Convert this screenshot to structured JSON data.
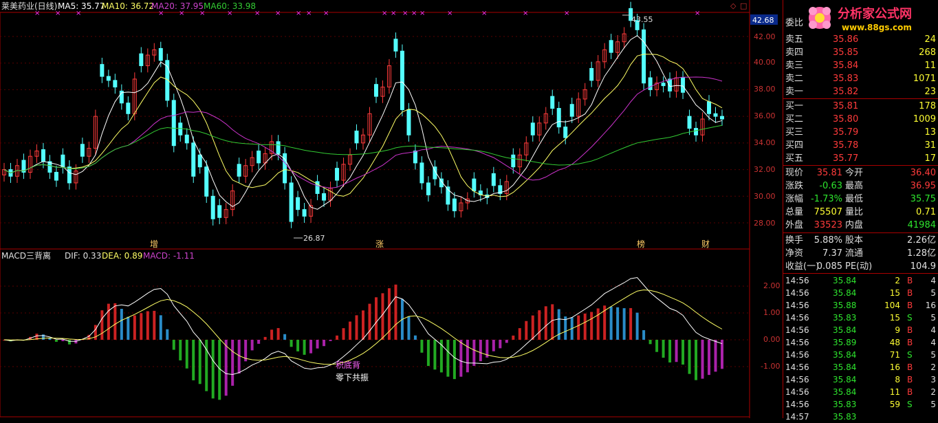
{
  "header": {
    "title": "莱美药业(日线)",
    "ma5": "MA5: 35.77",
    "ma10": "MA10: 36.72",
    "ma20": "MA20: 37.95",
    "ma60": "MA60: 33.98"
  },
  "price_axis": [
    "42.00",
    "40.00",
    "38.00",
    "36.00",
    "34.00",
    "32.00",
    "30.00",
    "28.00"
  ],
  "current_price_tag": "42.68",
  "annotations": {
    "high": "43.55",
    "low": "26.87"
  },
  "markers": [
    "增",
    "涨",
    "榜",
    "财"
  ],
  "macd_header": {
    "name": "MACD三背离",
    "dif": "DIF: 0.33",
    "dea": "DEA: 0.89",
    "macd": "MACD: -1.11"
  },
  "macd_axis": [
    "2.00",
    "1.00",
    "0.00",
    "-1.00"
  ],
  "macd_notes": [
    "积底背",
    "零下共振"
  ],
  "logo": {
    "title": "分析家公式网",
    "url": "www.88gs.com"
  },
  "orderbook": {
    "partial_label": "委比",
    "sells": [
      {
        "label": "卖五",
        "price": "35.86",
        "vol": "24"
      },
      {
        "label": "卖四",
        "price": "35.85",
        "vol": "268"
      },
      {
        "label": "卖三",
        "price": "35.84",
        "vol": "11"
      },
      {
        "label": "卖二",
        "price": "35.83",
        "vol": "1071"
      },
      {
        "label": "卖一",
        "price": "35.82",
        "vol": "23"
      }
    ],
    "buys": [
      {
        "label": "买一",
        "price": "35.81",
        "vol": "178"
      },
      {
        "label": "买二",
        "price": "35.80",
        "vol": "1009"
      },
      {
        "label": "买三",
        "price": "35.79",
        "vol": "13"
      },
      {
        "label": "买四",
        "price": "35.78",
        "vol": "31"
      },
      {
        "label": "买五",
        "price": "35.77",
        "vol": "17"
      }
    ]
  },
  "quote": [
    {
      "l1": "现价",
      "v1": "35.81",
      "c1": "up",
      "l2": "今开",
      "v2": "36.40",
      "c2": "up"
    },
    {
      "l1": "涨跌",
      "v1": "-0.63",
      "c1": "dn",
      "l2": "最高",
      "v2": "36.95",
      "c2": "up"
    },
    {
      "l1": "涨幅",
      "v1": "-1.73%",
      "c1": "dn",
      "l2": "最低",
      "v2": "35.75",
      "c2": "dn"
    },
    {
      "l1": "总量",
      "v1": "75507",
      "c1": "yel",
      "l2": "量比",
      "v2": "0.71",
      "c2": "yel"
    },
    {
      "l1": "外盘",
      "v1": "33523",
      "c1": "up",
      "l2": "内盘",
      "v2": "41984",
      "c2": "dn"
    }
  ],
  "fundamentals": [
    {
      "l1": "换手",
      "v1": "5.88%",
      "l2": "股本",
      "v2": "2.26亿"
    },
    {
      "l1": "净资",
      "v1": "7.37",
      "l2": "流通",
      "v2": "1.28亿"
    },
    {
      "l1": "收益(一)",
      "v1": "0.085",
      "l2": "PE(动)",
      "v2": "104.9"
    }
  ],
  "trades": [
    {
      "time": "14:56",
      "price": "35.84",
      "vol": "2",
      "side": "B",
      "n": "4"
    },
    {
      "time": "14:56",
      "price": "35.84",
      "vol": "15",
      "side": "B",
      "n": "5"
    },
    {
      "time": "14:56",
      "price": "35.88",
      "vol": "104",
      "side": "B",
      "n": "16"
    },
    {
      "time": "14:56",
      "price": "35.83",
      "vol": "15",
      "side": "S",
      "n": "5"
    },
    {
      "time": "14:56",
      "price": "35.84",
      "vol": "9",
      "side": "B",
      "n": "4"
    },
    {
      "time": "14:56",
      "price": "35.89",
      "vol": "48",
      "side": "B",
      "n": "4"
    },
    {
      "time": "14:56",
      "price": "35.84",
      "vol": "71",
      "side": "S",
      "n": "5"
    },
    {
      "time": "14:56",
      "price": "35.84",
      "vol": "16",
      "side": "B",
      "n": "2"
    },
    {
      "time": "14:56",
      "price": "35.84",
      "vol": "8",
      "side": "B",
      "n": "3"
    },
    {
      "time": "14:56",
      "price": "35.84",
      "vol": "11",
      "side": "B",
      "n": "2"
    },
    {
      "time": "14:56",
      "price": "35.83",
      "vol": "59",
      "side": "S",
      "n": "5"
    },
    {
      "time": "14:57",
      "price": "35.83",
      "vol": "",
      "side": "",
      "n": ""
    }
  ],
  "colors": {
    "up": "#ff3b3b",
    "down": "#54ffff",
    "ma5": "#ffffff",
    "ma10": "#ffff66",
    "ma20": "#cc33cc",
    "ma60": "#33cc33",
    "grid": "#800000"
  }
}
